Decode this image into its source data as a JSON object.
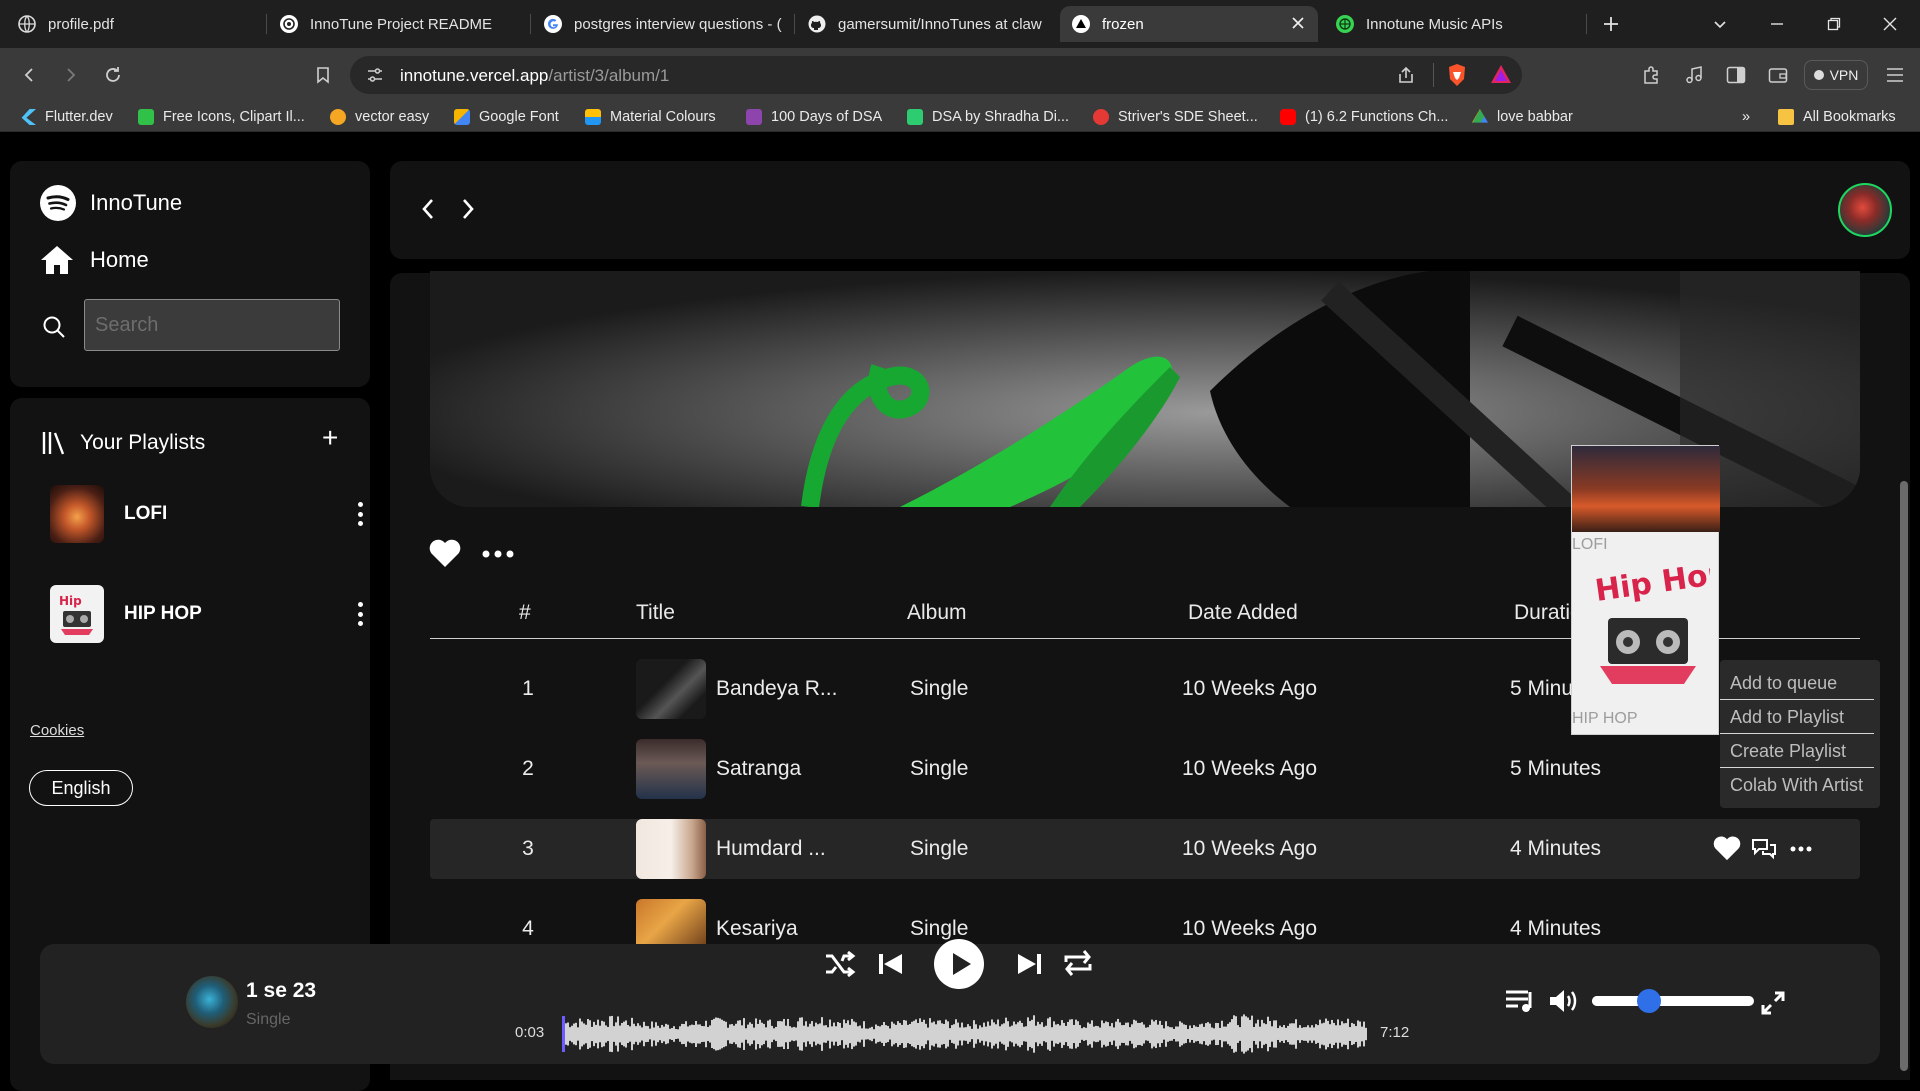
{
  "browser": {
    "tabs": [
      {
        "title": "profile.pdf",
        "active": false
      },
      {
        "title": "InnoTune Project README",
        "active": false
      },
      {
        "title": "postgres interview questions - (",
        "active": false
      },
      {
        "title": "gamersumit/InnoTunes at claw",
        "active": false
      },
      {
        "title": "frozen",
        "active": true
      },
      {
        "title": "Innotune Music APIs",
        "active": false
      }
    ],
    "url_host": "innotune.vercel.app",
    "url_path": "/artist/3/album/1",
    "vpn_label": "VPN",
    "bookmarks": [
      {
        "label": "Flutter.dev",
        "color": "#4fc3f7"
      },
      {
        "label": "Free Icons, Clipart Il...",
        "color": "#31c148"
      },
      {
        "label": "vector easy",
        "color": "#f5a623"
      },
      {
        "label": "Google Font",
        "color": "#f5b400"
      },
      {
        "label": "Material Colours",
        "color": "#2196f3"
      },
      {
        "label": "100 Days of DSA",
        "color": "#8e44ad"
      },
      {
        "label": "DSA by Shradha Di...",
        "color": "#2ecc71"
      },
      {
        "label": "Striver's SDE Sheet...",
        "color": "#e53935"
      },
      {
        "label": "(1) 6.2 Functions Ch...",
        "color": "#ff0000"
      },
      {
        "label": "love babbar",
        "color": "#34a853"
      }
    ],
    "bookmarks_overflow": "»",
    "all_bookmarks": "All Bookmarks"
  },
  "sidebar": {
    "brand": "InnoTune",
    "home_label": "Home",
    "search_placeholder": "Search",
    "playlists_title": "Your Playlists",
    "add_symbol": "+",
    "playlists": [
      {
        "name": "LOFI"
      },
      {
        "name": "HIP HOP"
      }
    ],
    "cookies": "Cookies",
    "language": "English"
  },
  "table": {
    "headers": {
      "num": "#",
      "title": "Title",
      "album": "Album",
      "date": "Date Added",
      "duration": "Duration"
    },
    "rows": [
      {
        "num": "1",
        "title": "Bandeya R...",
        "album": "Single",
        "date": "10 Weeks Ago",
        "duration": "5 Minutes"
      },
      {
        "num": "2",
        "title": "Satranga",
        "album": "Single",
        "date": "10 Weeks Ago",
        "duration": "5 Minutes"
      },
      {
        "num": "3",
        "title": "Humdard ...",
        "album": "Single",
        "date": "10 Weeks Ago",
        "duration": "4 Minutes"
      },
      {
        "num": "4",
        "title": "Kesariya",
        "album": "Single",
        "date": "10 Weeks Ago",
        "duration": "4 Minutes"
      }
    ]
  },
  "drag_preview": {
    "top_label": "LOFI",
    "bottom_label": "HIP HOP"
  },
  "context_menu": [
    "Add to queue",
    "Add to Playlist",
    "Create Playlist",
    "Colab With Artist"
  ],
  "player": {
    "title": "1 se 23",
    "album": "Single",
    "time_current": "0:03",
    "time_total": "7:12",
    "volume": 0.35,
    "accent": "#2f6fe8"
  },
  "colors": {
    "accent_green": "#1ed760",
    "panel": "#121212"
  }
}
